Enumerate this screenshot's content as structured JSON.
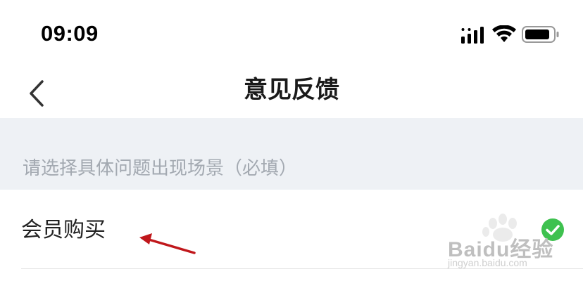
{
  "status_bar": {
    "time": "09:09",
    "icons": [
      "signal-icon",
      "wifi-icon",
      "battery-icon"
    ]
  },
  "nav": {
    "title": "意见反馈",
    "back_icon": "chevron-left-icon"
  },
  "section": {
    "label": "请选择具体问题出现场景（必填）"
  },
  "options": [
    {
      "label": "会员购买",
      "selected": true
    }
  ],
  "colors": {
    "section_bg": "#eef1f5",
    "section_text": "#a3a9b1",
    "check_green": "#3ec14f",
    "annotation_arrow": "#c0171b"
  },
  "watermark": {
    "text": "Baidu经验",
    "url": "jingyan.baidu.com"
  }
}
